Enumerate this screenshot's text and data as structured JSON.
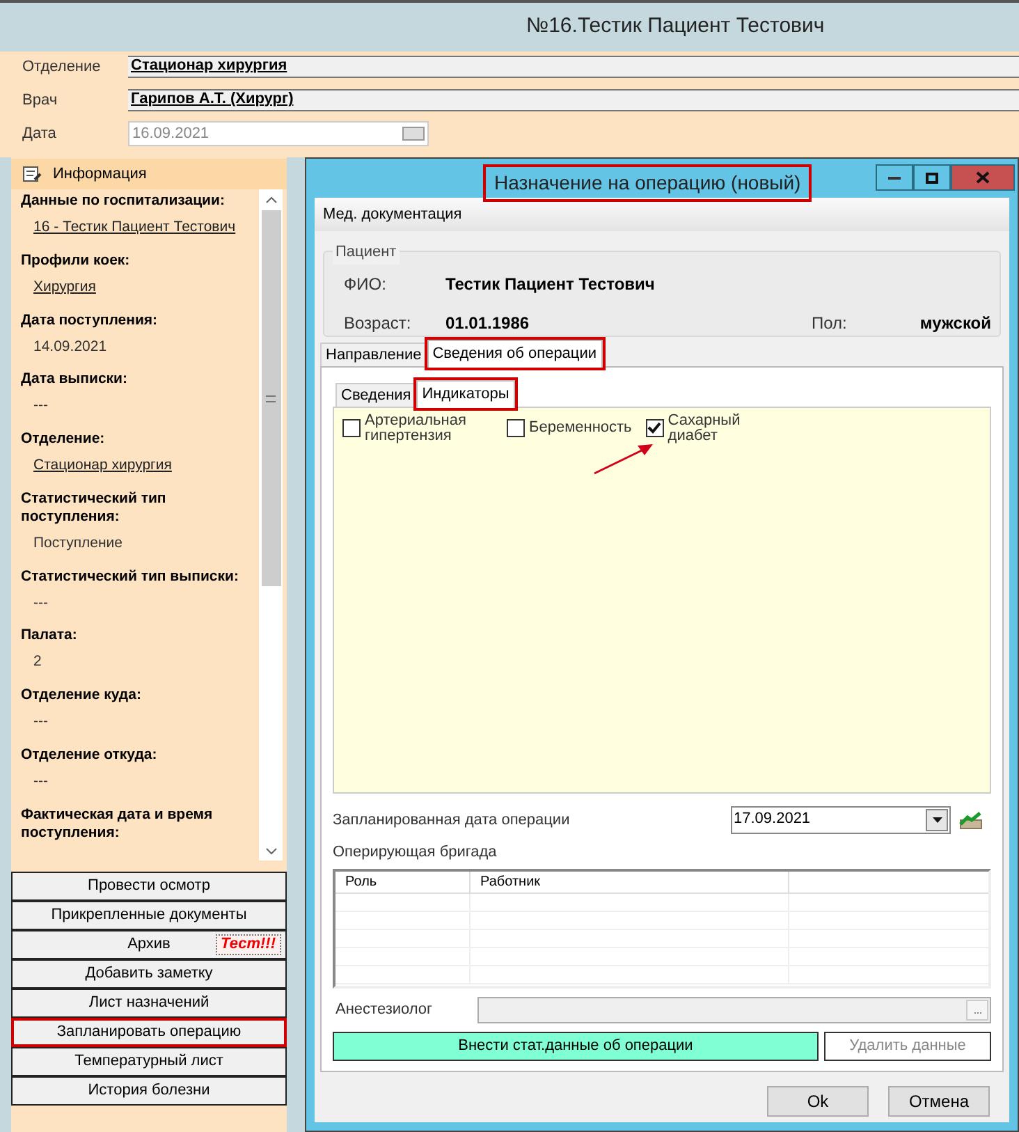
{
  "window": {
    "title": "№16.Тестик Пациент Тестович"
  },
  "header_fields": [
    {
      "label": "Отделение",
      "value": "Стационар  хирургия",
      "kind": "link"
    },
    {
      "label": "Врач",
      "value": "Гарипов А.Т. (Хирург)",
      "kind": "link"
    },
    {
      "label": "Дата",
      "value": "16.09.2021",
      "kind": "date",
      "disabled": true
    }
  ],
  "info_panel": {
    "title": "Информация",
    "items": [
      {
        "label": "Данные по госпитализации:",
        "value": "16 - Тестик Пациент Тестович",
        "kind": "link"
      },
      {
        "label": "Профили коек:",
        "value": "Хирургия",
        "kind": "link"
      },
      {
        "label": "Дата поступления:",
        "value": "14.09.2021",
        "kind": "plain"
      },
      {
        "label": "Дата выписки:",
        "value": "---",
        "kind": "plain"
      },
      {
        "label": "Отделение:",
        "value": "Стационар  хирургия",
        "kind": "link"
      },
      {
        "label": "Статистический тип поступления:",
        "value": "Поступление",
        "kind": "plain"
      },
      {
        "label": "Статистический тип выписки:",
        "value": "---",
        "kind": "plain"
      },
      {
        "label": "Палата:",
        "value": "2",
        "kind": "plain"
      },
      {
        "label": "Отделение куда:",
        "value": "---",
        "kind": "plain"
      },
      {
        "label": "Отделение откуда:",
        "value": "---",
        "kind": "plain"
      },
      {
        "label": "Фактическая дата и время поступления:",
        "kind": "label_only"
      }
    ]
  },
  "action_buttons": [
    {
      "label": "Провести осмотр",
      "highlighted": false
    },
    {
      "label": "Прикрепленные документы",
      "highlighted": false
    },
    {
      "label": "Архив",
      "highlighted": false,
      "badge": "Тест!!!"
    },
    {
      "label": "Добавить заметку",
      "highlighted": false
    },
    {
      "label": "Лист назначений",
      "highlighted": false
    },
    {
      "label": "Запланировать операцию",
      "highlighted": true
    },
    {
      "label": "Температурный лист",
      "highlighted": false
    },
    {
      "label": "История болезни",
      "highlighted": false
    }
  ],
  "dialog": {
    "title": "Назначение на операцию (новый)",
    "title_highlighted": true,
    "menu": [
      "Мед. документация"
    ],
    "patient": {
      "group_label": "Пациент",
      "fio_label": "ФИО:",
      "fio": "Тестик Пациент Тестович",
      "age_label": "Возраст:",
      "age": "01.01.1986",
      "sex_label": "Пол:",
      "sex": "мужской"
    },
    "tabs": [
      {
        "label": "Направление",
        "selected": false,
        "highlighted": false
      },
      {
        "label": "Сведения об операции",
        "selected": true,
        "highlighted": true
      }
    ],
    "subtabs": [
      {
        "label": "Сведения",
        "selected": false,
        "highlighted": false
      },
      {
        "label": "Индикаторы",
        "selected": true,
        "highlighted": true
      }
    ],
    "indicators": [
      {
        "label": "Артериальная гипертензия",
        "checked": false
      },
      {
        "label": "Беременность",
        "checked": false
      },
      {
        "label": "Сахарный диабет",
        "checked": true
      }
    ],
    "planned_date": {
      "label": "Запланированная дата операции",
      "value": "17.09.2021"
    },
    "team": {
      "label": "Оперирующая бригада",
      "columns": [
        "Роль",
        "Работник"
      ]
    },
    "anesthesiologist": {
      "label": "Анестезиолог"
    },
    "stat_button": "Внести стат.данные об операции",
    "delete_button": {
      "label": "Удалить данные",
      "disabled": true
    },
    "buttons": [
      "Ok",
      "Отмена"
    ]
  }
}
